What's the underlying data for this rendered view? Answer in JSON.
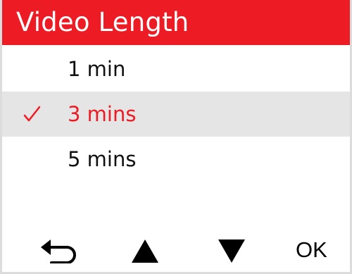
{
  "header": {
    "title": "Video Length"
  },
  "options": [
    {
      "label": "1 min",
      "selected": false
    },
    {
      "label": "3 mins",
      "selected": true
    },
    {
      "label": "5 mins",
      "selected": false
    }
  ],
  "footer": {
    "back_icon": "back-return-icon",
    "up_icon": "triangle-up-icon",
    "down_icon": "triangle-down-icon",
    "ok_label": "OK"
  },
  "colors": {
    "accent": "#ed1c24",
    "selected_background": "#e5e5e5",
    "text": "#111111"
  }
}
